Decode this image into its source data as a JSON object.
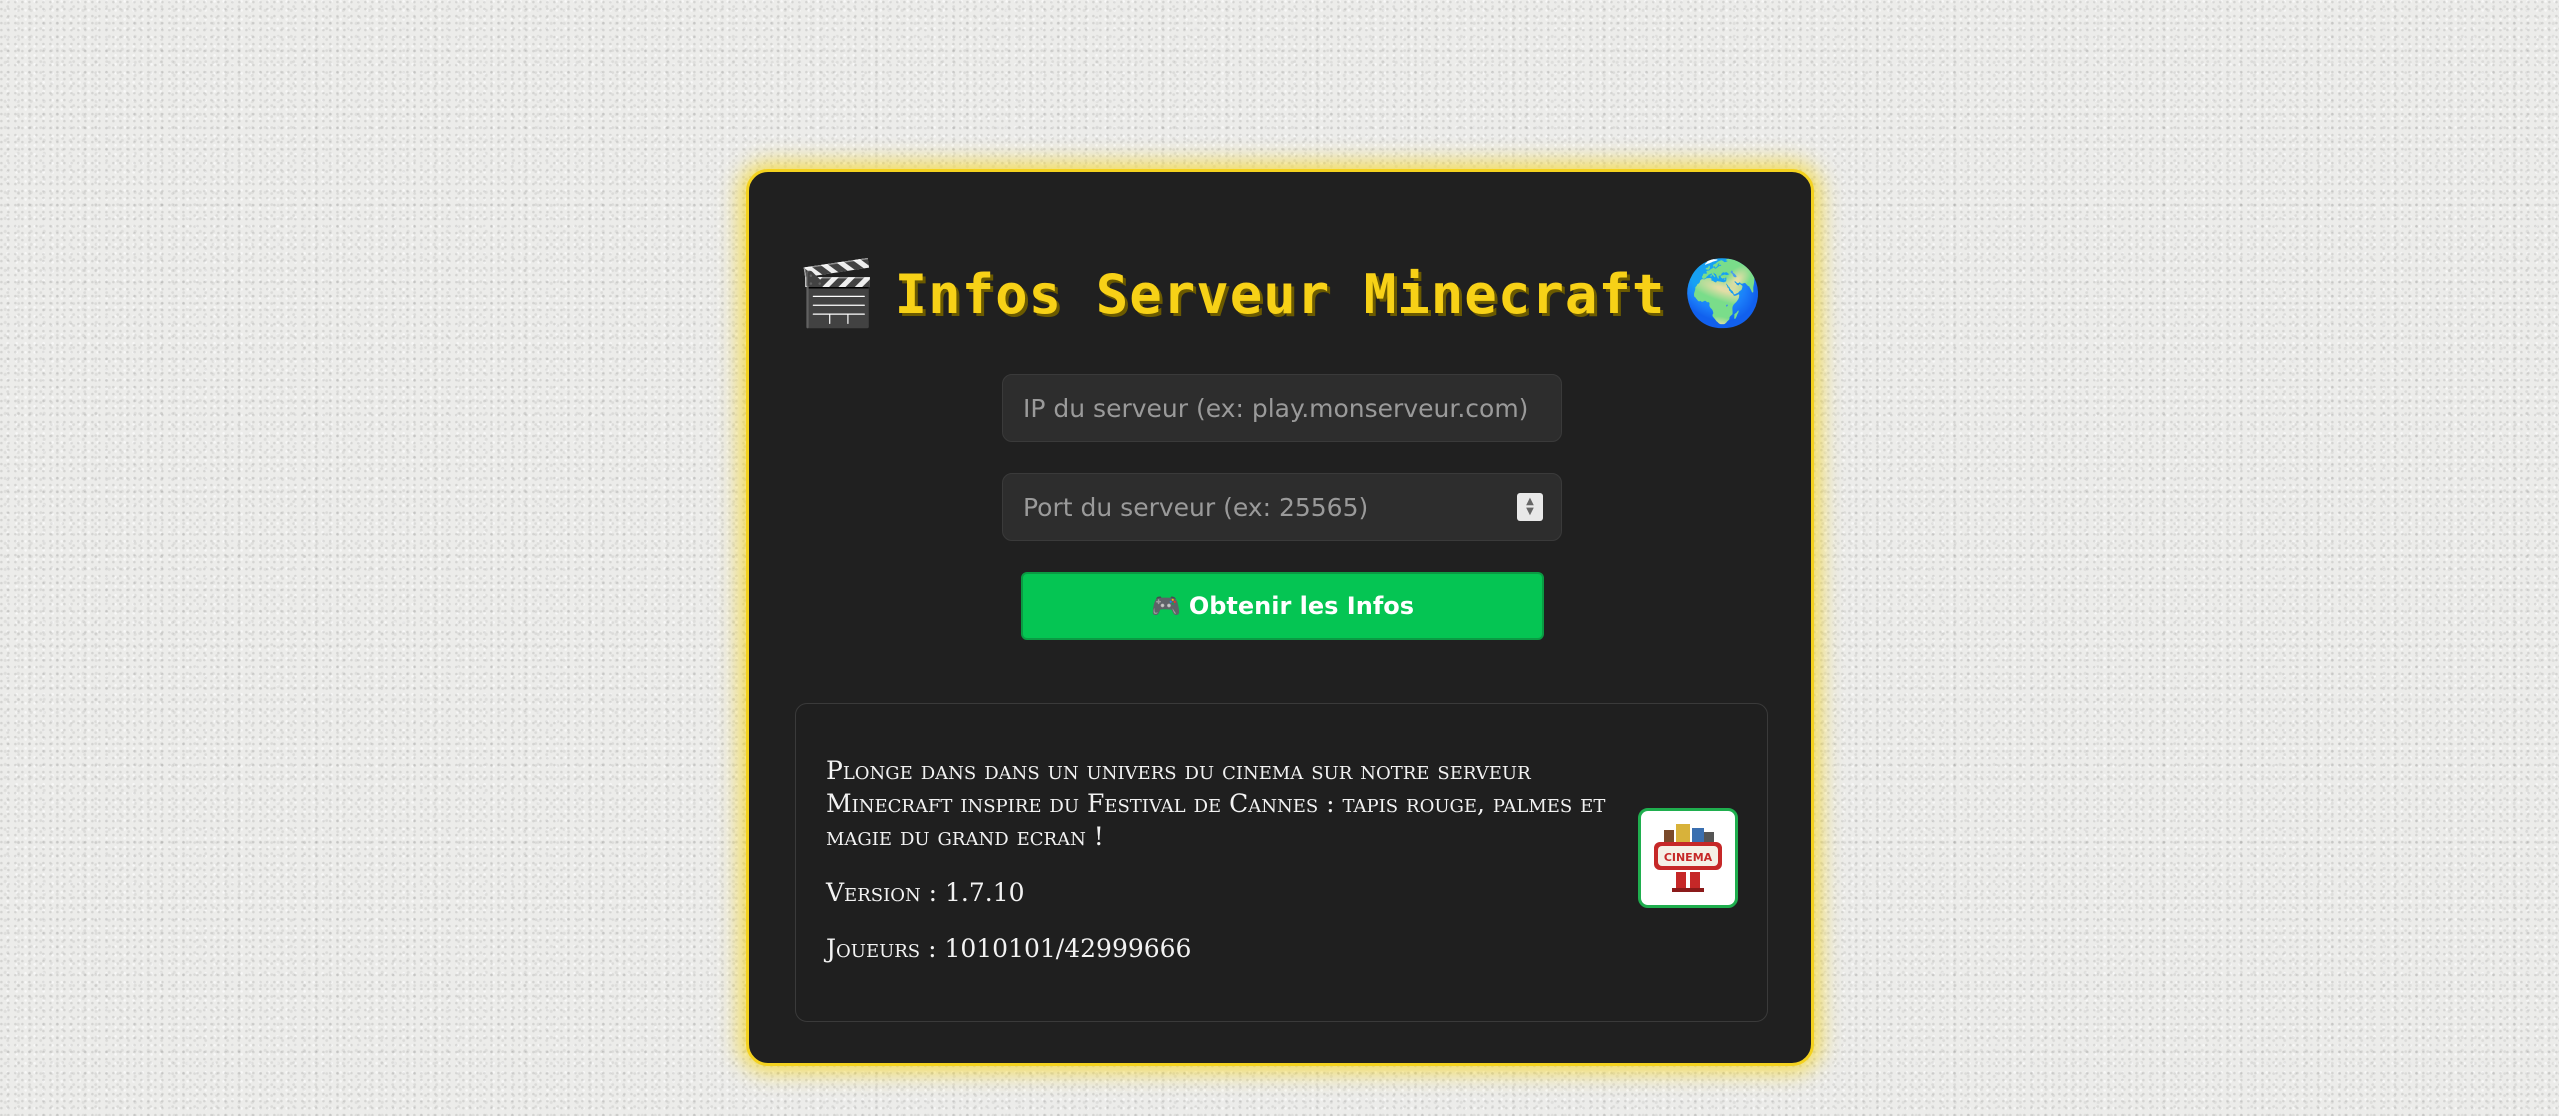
{
  "header": {
    "left_emoji": "🎬",
    "title": "Infos Serveur Minecraft",
    "right_emoji": "🌍"
  },
  "form": {
    "ip_placeholder": "IP du serveur (ex: play.monserveur.com)",
    "port_placeholder": "Port du serveur (ex: 25565)",
    "submit_icon": "🎮",
    "submit_label": "Obtenir les Infos"
  },
  "server_info": {
    "description": "Plonge dans dans un univers du cinema sur notre serveur Minecraft inspire du Festival de Cannes : tapis rouge, palmes et magie du grand ecran !",
    "version": "Version : 1.7.10",
    "players": "Joueurs : 1010101/42999666",
    "icon_text": "CINEMA"
  },
  "colors": {
    "accent_yellow": "#f7d117",
    "button_green": "#05c553",
    "card_bg": "#202020"
  }
}
